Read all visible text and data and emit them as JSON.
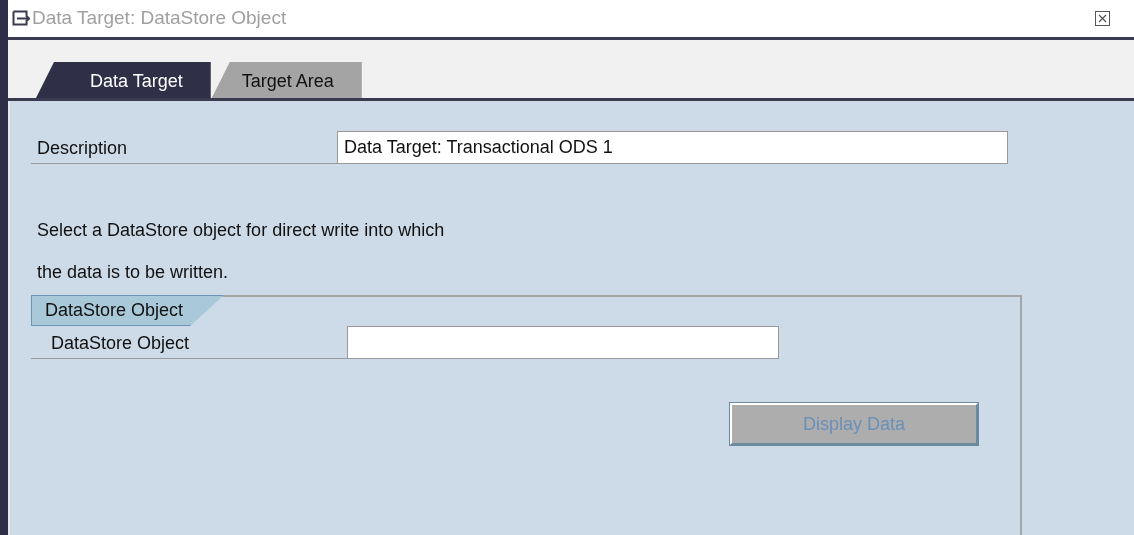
{
  "window": {
    "title": "Data Target: DataStore Object"
  },
  "tabs": [
    {
      "label": "Data Target",
      "selected": true
    },
    {
      "label": "Target Area",
      "selected": false
    }
  ],
  "description": {
    "label": "Description",
    "value": "Data Target: Transactional ODS 1"
  },
  "instruction": [
    "Select a DataStore object for direct write into which",
    "the data is to be written."
  ],
  "group": {
    "title": "DataStore Object",
    "field": {
      "label": "DataStore Object"
    },
    "button": {
      "label": "Display Data",
      "disabled": true
    }
  }
}
